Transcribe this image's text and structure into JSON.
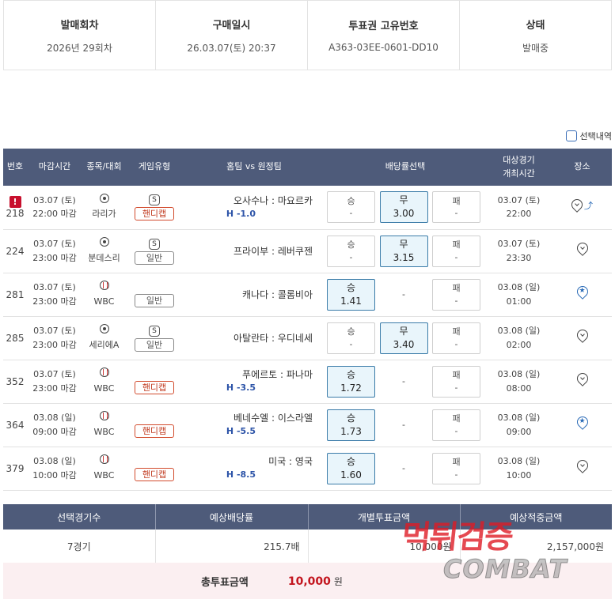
{
  "ticket_info": {
    "headers": [
      "발매회차",
      "구매일시",
      "투표권 고유번호",
      "상태"
    ],
    "values": [
      "2026년 29회차",
      "26.03.07(토) 20:37",
      "A363-03EE-0601-DD10",
      "발매중"
    ]
  },
  "select_history_label": "선택내역",
  "table_headers": {
    "no": "번호",
    "deadline": "마감시간",
    "sport": "종목/대회",
    "game_type": "게임유형",
    "teams": "홈팀 vs 원정팀",
    "odds": "배당률선택",
    "game_time_1": "대상경기",
    "game_time_2": "개최시간",
    "place": "장소"
  },
  "rows": [
    {
      "warn": "!",
      "no": "218",
      "date": "03.07 (토)",
      "close": "22:00 마감",
      "league": "라리가",
      "sport_icon": "soccer-icon",
      "s": "S",
      "type": "핸디캡",
      "teams": "오사수나 : 마요르카",
      "hcap": "H -1.0",
      "win": [
        "승",
        "-"
      ],
      "draw": [
        "무",
        "3.00"
      ],
      "lose": [
        "패",
        "-"
      ],
      "gdate": "03.07 (토)",
      "gtime": "22:00",
      "place_icon": "location-pin-icon",
      "extra_icon": "trend-icon"
    },
    {
      "warn": "",
      "no": "224",
      "date": "03.07 (토)",
      "close": "23:00 마감",
      "league": "분데스리",
      "sport_icon": "soccer-icon",
      "s": "S",
      "type": "일반",
      "teams": "프라이부 : 레버쿠젠",
      "hcap": "",
      "win": [
        "승",
        "-"
      ],
      "draw": [
        "무",
        "3.15"
      ],
      "lose": [
        "패",
        "-"
      ],
      "gdate": "03.07 (토)",
      "gtime": "23:30",
      "place_icon": "location-pin-icon"
    },
    {
      "warn": "",
      "no": "281",
      "date": "03.07 (토)",
      "close": "23:00 마감",
      "league": "WBC",
      "sport_icon": "baseball-icon",
      "s": "",
      "type": "일반",
      "teams": "캐나다 : 콜롬비아",
      "hcap": "",
      "win": [
        "승",
        "1.41"
      ],
      "draw": [
        "-"
      ],
      "lose": [
        "패",
        "-"
      ],
      "gdate": "03.08 (일)",
      "gtime": "01:00",
      "place_icon": "starred-pin-icon"
    },
    {
      "warn": "",
      "no": "285",
      "date": "03.07 (토)",
      "close": "23:00 마감",
      "league": "세리에A",
      "sport_icon": "soccer-icon",
      "s": "S",
      "type": "일반",
      "teams": "아탈란타 : 우디네세",
      "hcap": "",
      "win": [
        "승",
        "-"
      ],
      "draw": [
        "무",
        "3.40"
      ],
      "lose": [
        "패",
        "-"
      ],
      "gdate": "03.08 (일)",
      "gtime": "02:00",
      "place_icon": "location-pin-icon"
    },
    {
      "warn": "",
      "no": "352",
      "date": "03.07 (토)",
      "close": "23:00 마감",
      "league": "WBC",
      "sport_icon": "baseball-icon",
      "s": "",
      "type": "핸디캡",
      "teams": "푸에르토 : 파나마",
      "hcap": "H -3.5",
      "win": [
        "승",
        "1.72"
      ],
      "draw": [
        "-"
      ],
      "lose": [
        "패",
        "-"
      ],
      "gdate": "03.08 (일)",
      "gtime": "08:00",
      "place_icon": "location-pin-icon"
    },
    {
      "warn": "",
      "no": "364",
      "date": "03.08 (일)",
      "close": "09:00 마감",
      "league": "WBC",
      "sport_icon": "baseball-icon",
      "s": "",
      "type": "핸디캡",
      "teams": "베네수엘 : 이스라엘",
      "hcap": "H -5.5",
      "win": [
        "승",
        "1.73"
      ],
      "draw": [
        "-"
      ],
      "lose": [
        "패",
        "-"
      ],
      "gdate": "03.08 (일)",
      "gtime": "09:00",
      "place_icon": "starred-pin-icon"
    },
    {
      "warn": "",
      "no": "379",
      "date": "03.08 (일)",
      "close": "10:00 마감",
      "league": "WBC",
      "sport_icon": "baseball-icon",
      "s": "",
      "type": "핸디캡",
      "teams": "미국 : 영국",
      "hcap": "H -8.5",
      "win": [
        "승",
        "1.60"
      ],
      "draw": [
        "-"
      ],
      "lose": [
        "패",
        "-"
      ],
      "gdate": "03.08 (일)",
      "gtime": "10:00",
      "place_icon": "location-pin-icon"
    }
  ],
  "summary": {
    "headers": [
      "선택경기수",
      "예상배당률",
      "개별투표금액",
      "예상적중금액"
    ],
    "values": [
      "7경기",
      "215.7배",
      "10,000원",
      "2,157,000원"
    ],
    "total_label": "총투표금액",
    "total_value": "10,000",
    "total_unit": "원"
  },
  "watermark": {
    "korean": "먹튀검증",
    "english": "COMBAT"
  },
  "colors": {
    "header_bg": "#4e5b7a",
    "selected_odd_bg": "#e9f5fb",
    "handicap_red": "#c0391e",
    "hcap_blue": "#2d54a8",
    "total_red": "#c3151e"
  }
}
